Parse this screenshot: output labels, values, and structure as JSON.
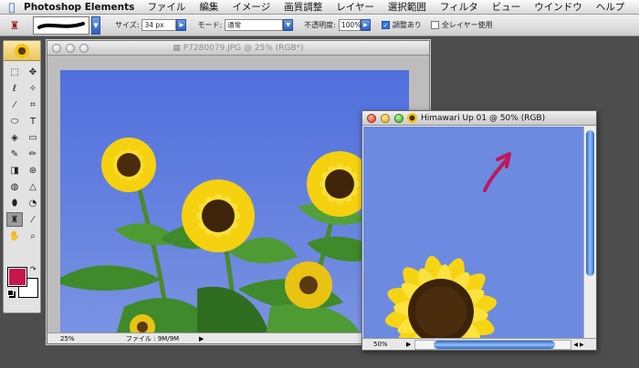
{
  "menubar": {
    "apple_glyph": "",
    "app_name": "Photoshop Elements",
    "items": [
      "ファイル",
      "編集",
      "イメージ",
      "画質調整",
      "レイヤー",
      "選択範囲",
      "フィルタ",
      "ビュー",
      "ウインドウ",
      "ヘルプ"
    ]
  },
  "options": {
    "size_label": "サイズ:",
    "size_value": "34 px",
    "mode_label": "モード:",
    "mode_value": "通常",
    "opacity_label": "不透明度:",
    "opacity_value": "100%",
    "adjust_label": "調整あり",
    "adjust_checked": true,
    "all_layers_label": "全レイヤー使用",
    "all_layers_checked": false
  },
  "toolbox": {
    "tools": [
      {
        "name": "marquee-tool",
        "glyph": "⬚"
      },
      {
        "name": "move-tool",
        "glyph": "✥"
      },
      {
        "name": "lasso-tool",
        "glyph": "ℓ"
      },
      {
        "name": "magic-wand-tool",
        "glyph": "✧"
      },
      {
        "name": "selection-brush-tool",
        "glyph": "⁄"
      },
      {
        "name": "crop-tool",
        "glyph": "⌗"
      },
      {
        "name": "shape-tool",
        "glyph": "⬭"
      },
      {
        "name": "type-tool",
        "glyph": "T"
      },
      {
        "name": "paint-bucket-tool",
        "glyph": "◈"
      },
      {
        "name": "gradient-tool",
        "glyph": "▭"
      },
      {
        "name": "brush-tool",
        "glyph": "✎"
      },
      {
        "name": "pencil-tool",
        "glyph": "✏"
      },
      {
        "name": "eraser-tool",
        "glyph": "◨"
      },
      {
        "name": "red-eye-tool",
        "glyph": "⊛"
      },
      {
        "name": "blur-tool",
        "glyph": "◍"
      },
      {
        "name": "sharpen-tool",
        "glyph": "△"
      },
      {
        "name": "sponge-tool",
        "glyph": "⬮"
      },
      {
        "name": "dodge-tool",
        "glyph": "◔"
      },
      {
        "name": "clone-stamp-tool",
        "glyph": "♜"
      },
      {
        "name": "eyedropper-tool",
        "glyph": "⁄"
      },
      {
        "name": "hand-tool",
        "glyph": "✋"
      },
      {
        "name": "zoom-tool",
        "glyph": "⌕"
      }
    ],
    "active_tool": "clone-stamp-tool",
    "foreground_color": "#c8154a",
    "background_color": "#ffffff"
  },
  "window1": {
    "title": "P7280079.JPG @ 25% (RGB*)",
    "zoom": "25%",
    "file_info": "ファイル : 9M/9M"
  },
  "window2": {
    "title": "Himawari  Up 01 @ 50% (RGB)",
    "zoom": "50%"
  },
  "colors": {
    "sky": "#5b77da",
    "petal": "#f5d10f",
    "leaf": "#3f8a2a",
    "selection_accent": "#2b63c9"
  }
}
